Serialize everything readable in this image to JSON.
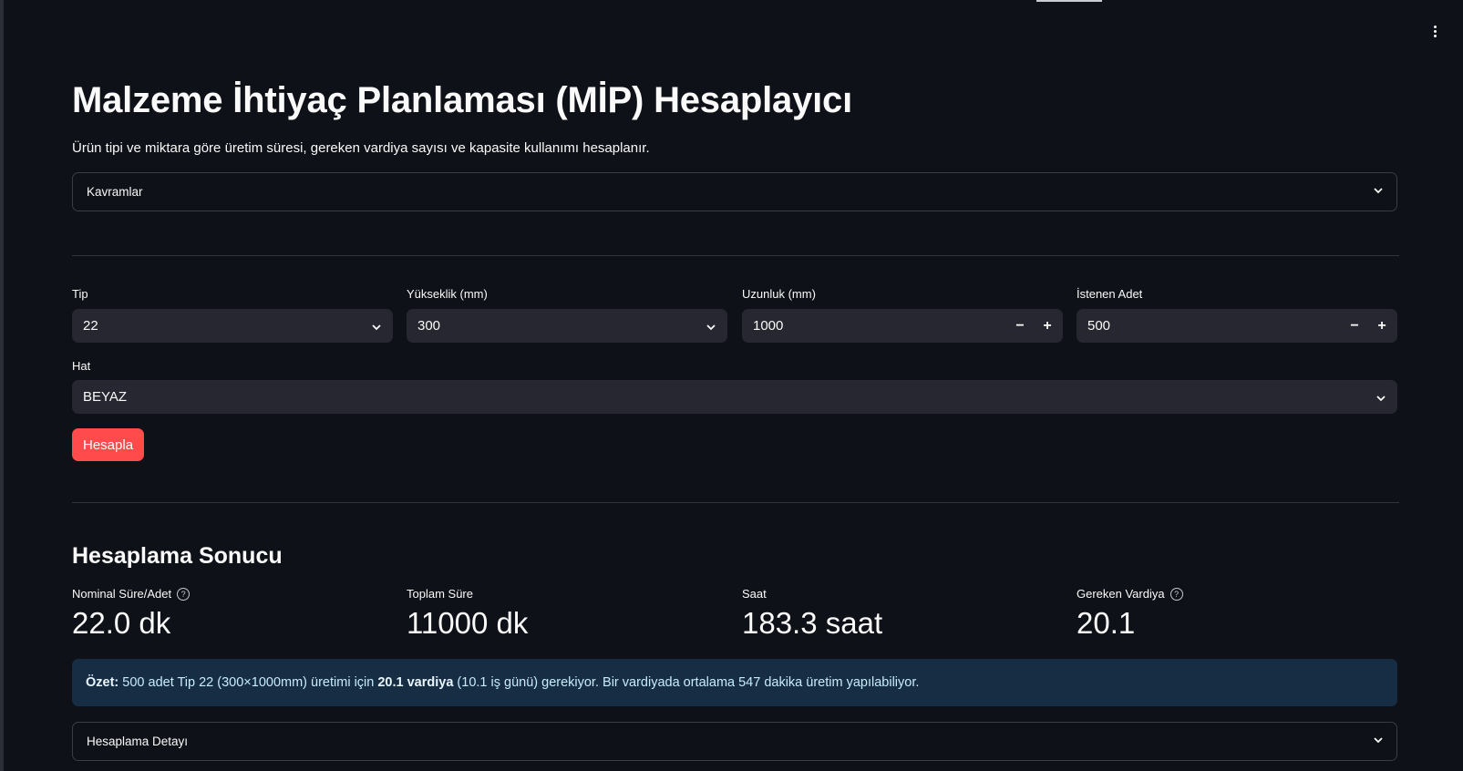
{
  "app": {
    "title": "Malzeme İhtiyaç Planlaması (MİP) Hesaplayıcı",
    "subtitle": "Ürün tipi ve miktara göre üretim süresi, gereken vardiya sayısı ve kapasite kullanımı hesaplanır."
  },
  "concepts_expander": {
    "label": "Kavramlar"
  },
  "form": {
    "type": {
      "label": "Tip",
      "value": "22"
    },
    "height": {
      "label": "Yükseklik (mm)",
      "value": "300"
    },
    "length": {
      "label": "Uzunluk (mm)",
      "value": "1000"
    },
    "quantity": {
      "label": "İstenen Adet",
      "value": "500"
    },
    "line": {
      "label": "Hat",
      "value": "BEYAZ"
    },
    "stepper": {
      "minus": "−",
      "plus": "+"
    },
    "calculate_label": "Hesapla"
  },
  "result": {
    "heading": "Hesaplama Sonucu",
    "metrics": [
      {
        "label": "Nominal Süre/Adet",
        "value": "22.0 dk",
        "help": "?"
      },
      {
        "label": "Toplam Süre",
        "value": "11000 dk"
      },
      {
        "label": "Saat",
        "value": "183.3 saat"
      },
      {
        "label": "Gereken Vardiya",
        "value": "20.1",
        "help": "?"
      }
    ],
    "summary": {
      "prefix": "Özet:",
      "part1": " 500 adet Tip 22 (300×1000mm) üretimi için ",
      "shifts": "20.1 vardiya",
      "part2": " (10.1 iş günü) gerekiyor. Bir vardiyada ortalama 547 dakika üretim yapılabiliyor."
    },
    "detail_expander": {
      "label": "Hesaplama Detayı"
    }
  },
  "colors": {
    "background": "#0e1117",
    "input_bg": "#262730",
    "primary": "#ff4b4b",
    "info_bg": "#172d43"
  }
}
